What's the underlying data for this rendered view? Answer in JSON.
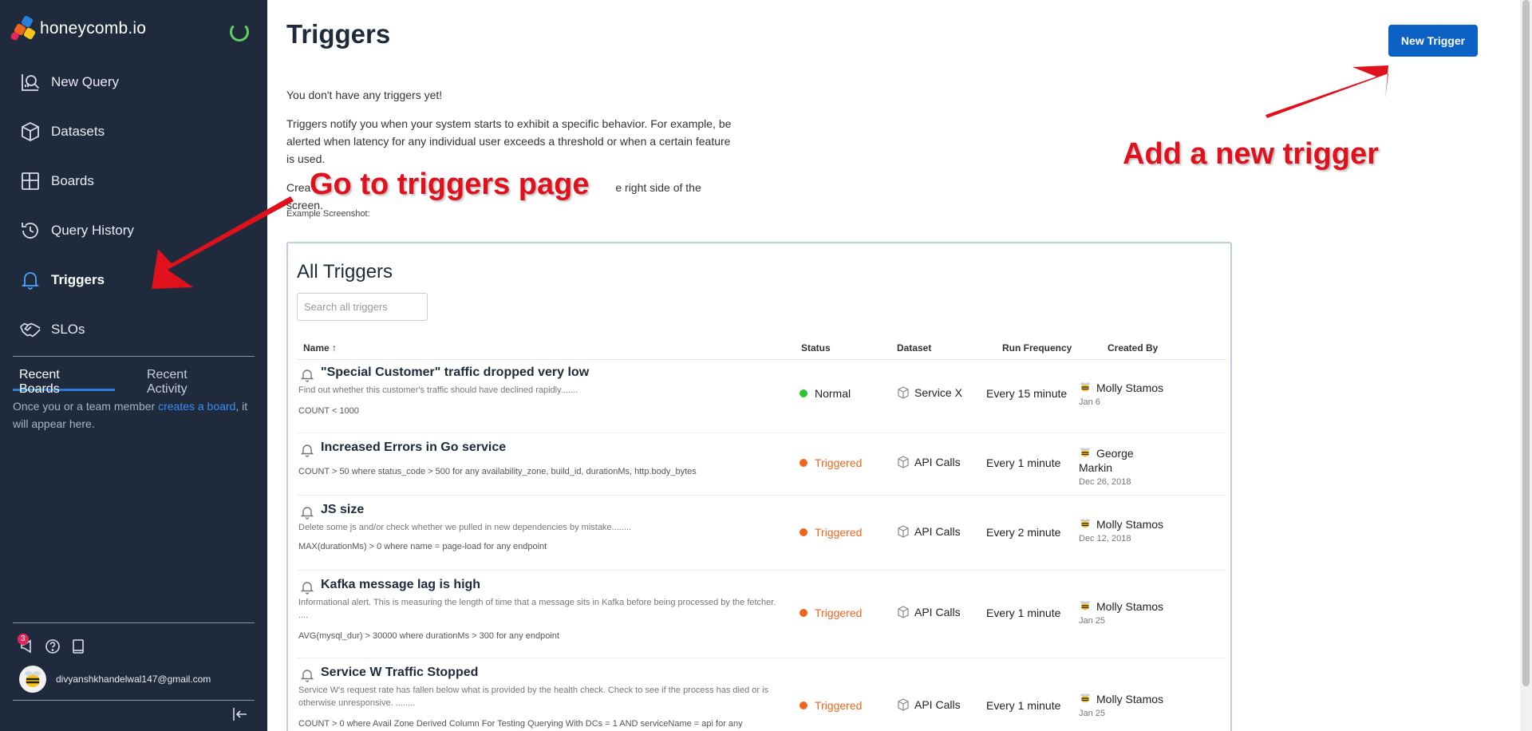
{
  "brand": {
    "name": "honeycomb.io"
  },
  "sidebar": {
    "items": [
      {
        "label": "New Query",
        "icon": "query-icon"
      },
      {
        "label": "Datasets",
        "icon": "cube-icon"
      },
      {
        "label": "Boards",
        "icon": "boards-icon"
      },
      {
        "label": "Query History",
        "icon": "history-icon"
      },
      {
        "label": "Triggers",
        "icon": "bell-icon",
        "active": true
      },
      {
        "label": "SLOs",
        "icon": "handshake-icon"
      }
    ],
    "tabs": [
      {
        "label": "Recent Boards"
      },
      {
        "label": "Recent Activity"
      }
    ],
    "recent_text_prefix": "Once you or a team member ",
    "recent_link": "creates a board",
    "recent_text_suffix": ", it will appear here.",
    "notification_count": "3",
    "user_email": "divyanshkhandelwal147@gmail.com"
  },
  "main": {
    "title": "Triggers",
    "new_trigger_label": "New Trigger",
    "intro_1": "You don't have any triggers yet!",
    "intro_2": "Triggers notify you when your system starts to exhibit a specific behavior. For example, be alerted when latency for any individual user exceeds a threshold or when a certain feature is used.",
    "intro_3_start": "Crea",
    "intro_3_end": "e right side of the screen.",
    "example_label": "Example Screenshot:"
  },
  "example": {
    "title": "All Triggers",
    "search_placeholder": "Search all triggers",
    "columns": {
      "name": "Name",
      "status": "Status",
      "dataset": "Dataset",
      "frequency": "Run Frequency",
      "created_by": "Created By"
    },
    "rows": [
      {
        "name": "\"Special Customer\" traffic dropped very low",
        "desc": "Find out whether this customer's traffic should have declined rapidly.......",
        "query": "COUNT < 1000",
        "status": "Normal",
        "dataset": "Service X",
        "frequency": "Every 15 minute",
        "creator": "Molly Stamos",
        "date": "Jan 6"
      },
      {
        "name": "Increased Errors in Go service",
        "desc": "",
        "query": "COUNT > 50 where status_code > 500 for any availability_zone, build_id, durationMs, http.body_bytes",
        "status": "Triggered",
        "dataset": "API Calls",
        "frequency": "Every 1 minute",
        "creator": "George Markin",
        "date": "Dec 26, 2018"
      },
      {
        "name": "JS size",
        "desc": "Delete some js and/or check whether we pulled in new dependencies by mistake........",
        "query": "MAX(durationMs) > 0 where name = page-load for any endpoint",
        "status": "Triggered",
        "dataset": "API Calls",
        "frequency": "Every 2 minute",
        "creator": "Molly Stamos",
        "date": "Dec 12, 2018"
      },
      {
        "name": "Kafka message lag is high",
        "desc": "Informational alert. This is measuring the length of time that a message sits in Kafka before being processed by the fetcher. ....",
        "query": "AVG(mysql_dur) > 30000 where durationMs > 300 for any endpoint",
        "status": "Triggered",
        "dataset": "API Calls",
        "frequency": "Every 1 minute",
        "creator": "Molly Stamos",
        "date": "Jan 25"
      },
      {
        "name": "Service W Traffic Stopped",
        "desc": "Service W's request rate has fallen below what is provided by the health check. Check to see if the process has died or is otherwise unresponsive. ........",
        "query": "COUNT > 0 where Avail Zone Derived Column For Testing Querying With DCs = 1 AND serviceName = api for any",
        "status": "Triggered",
        "dataset": "API Calls",
        "frequency": "Every 1 minute",
        "creator": "Molly Stamos",
        "date": "Jan 25"
      }
    ]
  },
  "annotations": {
    "triggers_page": "Go to triggers page",
    "new_trigger": "Add a new trigger"
  },
  "colors": {
    "sidebar_bg": "#1f2a3c",
    "primary": "#0b62c4",
    "normal": "#2fc22f",
    "triggered": "#f0651e",
    "annotation": "#e0101d"
  }
}
